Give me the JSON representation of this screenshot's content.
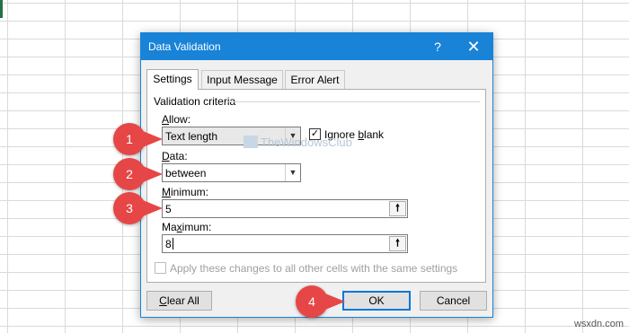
{
  "dialog": {
    "title": "Data Validation",
    "help_glyph": "?",
    "close_glyph": "✕",
    "tabs": [
      {
        "label": "Settings",
        "active": true
      },
      {
        "label": "Input Message",
        "active": false
      },
      {
        "label": "Error Alert",
        "active": false
      }
    ],
    "section_title": "Validation criteria",
    "allow": {
      "label_u": "A",
      "label_rest": "llow:",
      "value": "Text length"
    },
    "ignore_blank": {
      "label_u": "b",
      "label_pre": "Ignore ",
      "label_rest": "lank",
      "checked": true,
      "check_glyph": "✓"
    },
    "data": {
      "label_u": "D",
      "label_rest": "ata:",
      "value": "between"
    },
    "minimum": {
      "label_u": "M",
      "label_rest": "inimum:",
      "value": "5"
    },
    "maximum": {
      "label_u": "x",
      "label_pre": "Ma",
      "label_rest": "imum:",
      "value": "8"
    },
    "range_button_glyph": "🠕",
    "dropdown_glyph": "▼",
    "apply_all": {
      "label": "Apply these changes to all other cells with the same settings",
      "checked": false,
      "enabled": false
    },
    "buttons": {
      "clear_u": "C",
      "clear_rest": "lear All",
      "ok": "OK",
      "cancel": "Cancel"
    }
  },
  "annotations": [
    "1",
    "2",
    "3",
    "4"
  ],
  "watermark": "TheWindowsClub",
  "site_mark": "wsxdn.com",
  "colors": {
    "titlebar": "#1883d7",
    "badge": "#e74646",
    "ok_border": "#0078d7",
    "excel_green": "#217346"
  }
}
